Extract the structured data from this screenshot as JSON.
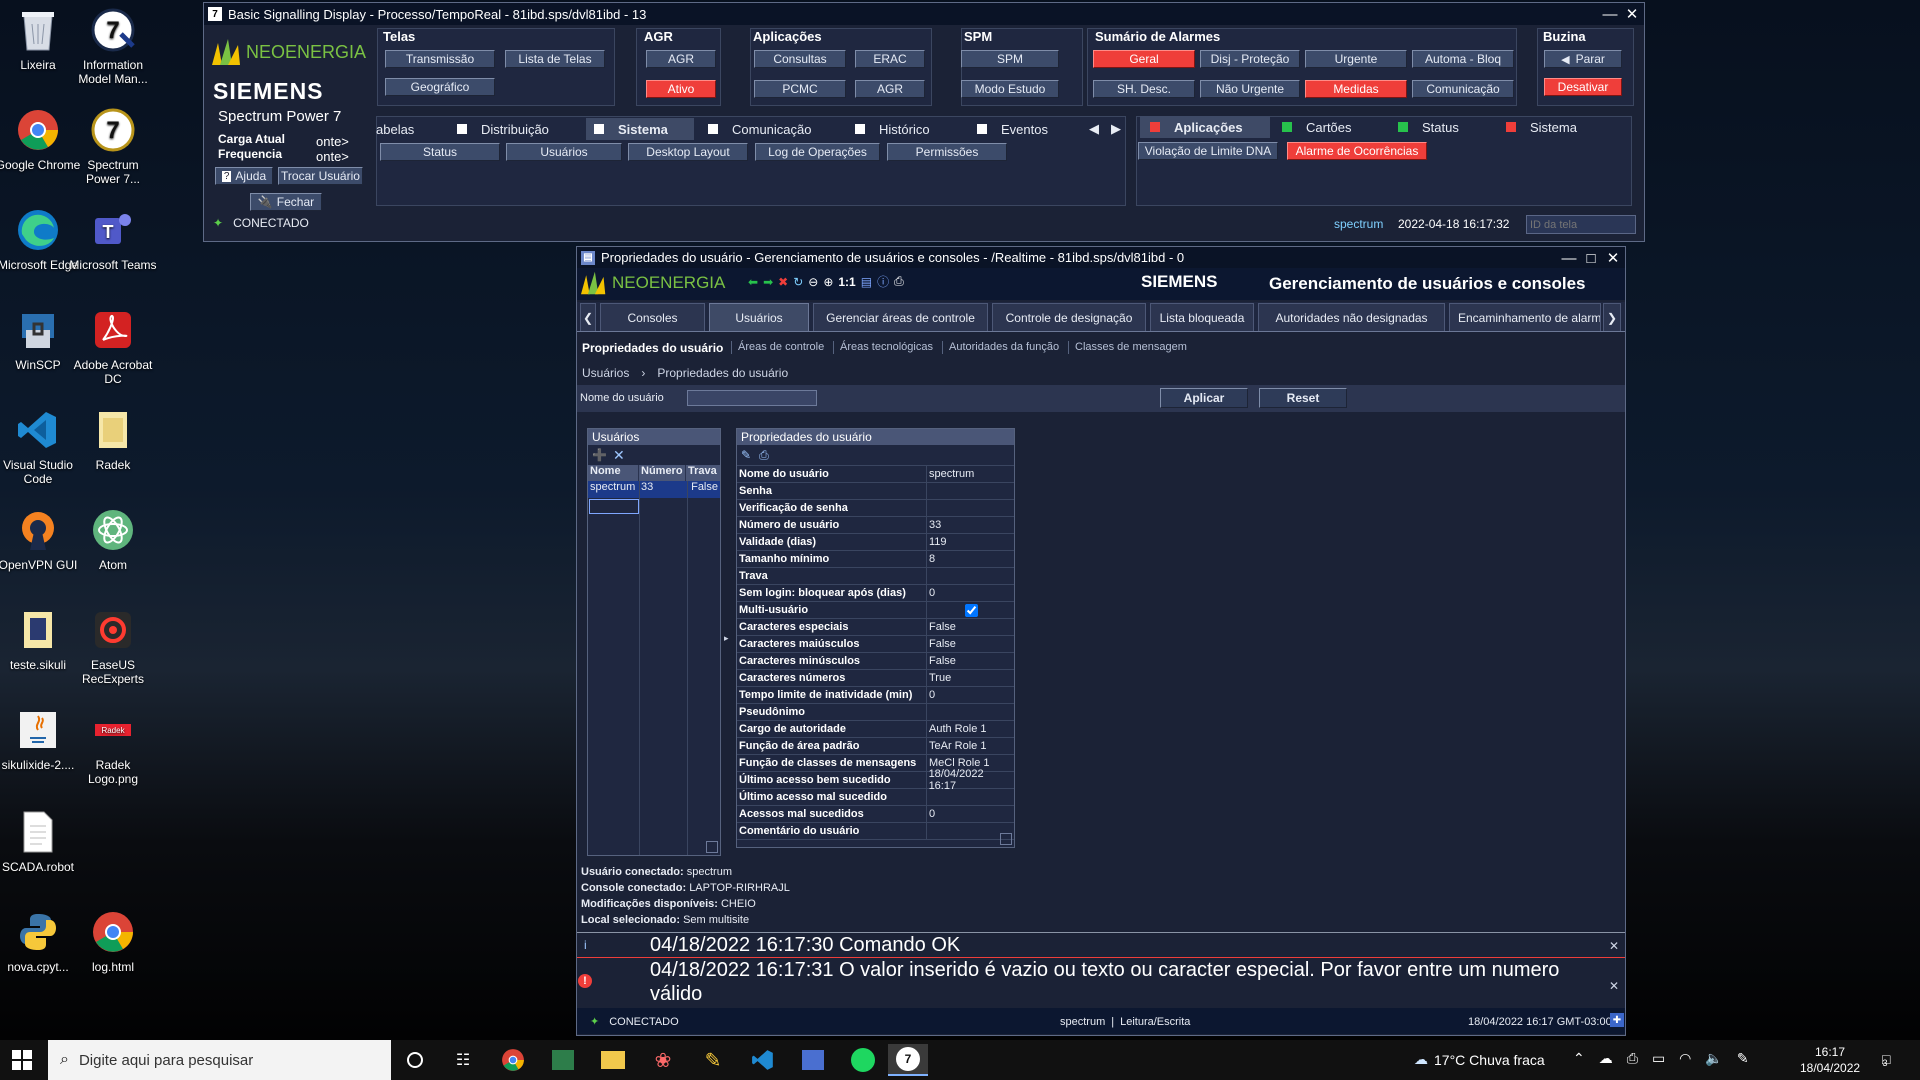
{
  "desktop": {
    "icons": [
      {
        "label": "Lixeira",
        "icon": "recycle-bin-icon"
      },
      {
        "label": "Information Model Man...",
        "icon": "spectrum7-icon"
      },
      {
        "label": "Google Chrome",
        "icon": "chrome-icon"
      },
      {
        "label": "Spectrum Power 7...",
        "icon": "spectrum7-icon"
      },
      {
        "label": "Microsoft Edge",
        "icon": "edge-icon"
      },
      {
        "label": "Microsoft Teams",
        "icon": "teams-icon"
      },
      {
        "label": "WinSCP",
        "icon": "winscp-icon"
      },
      {
        "label": "Adobe Acrobat DC",
        "icon": "acrobat-icon"
      },
      {
        "label": "Visual Studio Code",
        "icon": "vscode-icon"
      },
      {
        "label": "Radek",
        "icon": "folder-icon"
      },
      {
        "label": "OpenVPN GUI",
        "icon": "openvpn-icon"
      },
      {
        "label": "Atom",
        "icon": "atom-icon"
      },
      {
        "label": "teste.sikuli",
        "icon": "folder-icon"
      },
      {
        "label": "EaseUS RecExperts",
        "icon": "recexperts-icon"
      },
      {
        "label": "sikulixide-2....",
        "icon": "java-icon"
      },
      {
        "label": "Radek Logo.png",
        "icon": "image-icon"
      },
      {
        "label": "SCADA.robot",
        "icon": "file-icon"
      },
      {
        "label": "nova.cpyt...",
        "icon": "python-icon"
      },
      {
        "label": "log.html",
        "icon": "chrome-icon"
      }
    ]
  },
  "bsd": {
    "title": "Basic Signalling Display - Processo/TempoReal - 81ibd.sps/dvl81ibd - 13",
    "logo_neo": "NEOENERGIA",
    "logo_siemens": "SIEMENS",
    "product": "Spectrum Power 7",
    "carga": "Carga Atual",
    "freq": "Frequencia",
    "carga_suffix": "onte>",
    "freq_suffix": "onte>",
    "help": "Ajuda",
    "switch_user": "Trocar Usuário",
    "close": "Fechar",
    "telas": {
      "label": "Telas",
      "b1": "Transmissão",
      "b2": "Lista de Telas",
      "b3": "Geográfico"
    },
    "agr": {
      "label": "AGR",
      "b1": "AGR",
      "b2": "Ativo"
    },
    "apps": {
      "label": "Aplicações",
      "b1": "Consultas",
      "b2": "ERAC",
      "b3": "PCMC",
      "b4": "AGR"
    },
    "spm": {
      "label": "SPM",
      "b1": "SPM",
      "b2": "Modo Estudo"
    },
    "alarms": {
      "label": "Sumário de Alarmes",
      "b1": "Geral",
      "b2": "Disj - Proteção",
      "b3": "Urgente",
      "b4": "Automa - Bloq",
      "b5": "SH. Desc.",
      "b6": "Não Urgente",
      "b7": "Medidas",
      "b8": "Comunicação"
    },
    "buzina": {
      "label": "Buzina",
      "b1": "Parar",
      "b2": "Desativar"
    },
    "tabs": [
      "abelas",
      "Distribuição",
      "Sistema",
      "Comunicação",
      "Histórico",
      "Eventos"
    ],
    "subbuttons": [
      "Status",
      "Usuários",
      "Desktop Layout",
      "Log de Operações",
      "Permissões"
    ],
    "right_tabs": [
      "Aplicações",
      "Cartões",
      "Status",
      "Sistema"
    ],
    "right_buttons": [
      "Violação de Limite DNA",
      "Alarme de Ocorrências"
    ],
    "status": "CONECTADO",
    "user": "spectrum",
    "datetime": "2022-04-18 16:17:32",
    "screen_id_placeholder": "ID da tela"
  },
  "umc": {
    "title": "Propriedades do usuário - Gerenciamento de usuários e consoles - /Realtime - 81ibd.sps/dvl81ibd - 0",
    "logo_neo": "NEOENERGIA",
    "zoom_label": "1:1",
    "logo_siemens": "SIEMENS",
    "heading": "Gerenciamento de usuários e consoles",
    "tabs": [
      "Consoles",
      "Usuários",
      "Gerenciar áreas de controle",
      "Controle de designação",
      "Lista bloqueada",
      "Autoridades não designadas",
      "Encaminhamento de alarm"
    ],
    "subnav": [
      "Propriedades do usuário",
      "Áreas de controle",
      "Áreas tecnológicas",
      "Autoridades da função",
      "Classes de mensagem"
    ],
    "breadcrumb": {
      "root": "Usuários",
      "sep": "›",
      "leaf": "Propriedades do usuário"
    },
    "filter": {
      "label": "Nome do usuário",
      "value": "",
      "apply": "Aplicar",
      "reset": "Reset"
    },
    "users_table": {
      "title": "Usuários",
      "columns": [
        "Nome",
        "Número",
        "Trava"
      ],
      "rows": [
        [
          "spectrum",
          "33",
          "False"
        ]
      ]
    },
    "props": {
      "title": "Propriedades do usuário",
      "rows": [
        [
          "Nome do usuário",
          "spectrum"
        ],
        [
          "Senha",
          ""
        ],
        [
          "Verificação de senha",
          ""
        ],
        [
          "Número de usuário",
          "33"
        ],
        [
          "Validade (dias)",
          "119"
        ],
        [
          "Tamanho mínimo",
          "8"
        ],
        [
          "Trava",
          ""
        ],
        [
          "Sem login: bloquear após (dias)",
          "0"
        ],
        [
          "Multi-usuário",
          ""
        ],
        [
          "Caracteres especiais",
          "False"
        ],
        [
          "Caracteres maiúsculos",
          "False"
        ],
        [
          "Caracteres minúsculos",
          "False"
        ],
        [
          "Caracteres números",
          "True"
        ],
        [
          "Tempo limite de inatividade (min)",
          "0"
        ],
        [
          "Pseudônimo",
          ""
        ],
        [
          "Cargo de autoridade",
          "Auth Role 1"
        ],
        [
          "Função de área padrão",
          "TeAr Role 1"
        ],
        [
          "Função de classes de mensagens",
          "MeCl Role 1"
        ],
        [
          "Último acesso bem sucedido",
          "18/04/2022 16:17"
        ],
        [
          "Último acesso mal sucedido",
          ""
        ],
        [
          "Acessos mal sucedidos",
          "0"
        ],
        [
          "Comentário do usuário",
          ""
        ]
      ],
      "multi_user_checked": true
    },
    "info": {
      "user_label": "Usuário conectado:",
      "user": "spectrum",
      "console_label": "Console conectado:",
      "console": "LAPTOP-RIRHRAJL",
      "mods_label": "Modificações disponíveis:",
      "mods": "CHEIO",
      "site_label": "Local selecionado:",
      "site": "Sem multisite"
    },
    "messages": [
      {
        "text": "04/18/2022 16:17:30 Comando OK",
        "type": "info"
      },
      {
        "text": "04/18/2022 16:17:31 O valor inserido é vazio ou texto ou caracter especial. Por favor entre um numero válido",
        "type": "error"
      }
    ],
    "status": {
      "conn": "CONECTADO",
      "user": "spectrum",
      "sep": "|",
      "mode": "Leitura/Escrita",
      "datetime": "18/04/2022 16:17 GMT-03:00"
    }
  },
  "taskbar": {
    "search_placeholder": "Digite aqui para pesquisar",
    "weather": "17°C  Chuva fraca",
    "time": "16:17",
    "date": "18/04/2022",
    "notif_count": "3"
  },
  "colors": {
    "alarm_red": "#ef3e3a",
    "dark_bg": "#1b2236",
    "title_bg": "#0a1326",
    "button": "#3c4b6a"
  }
}
